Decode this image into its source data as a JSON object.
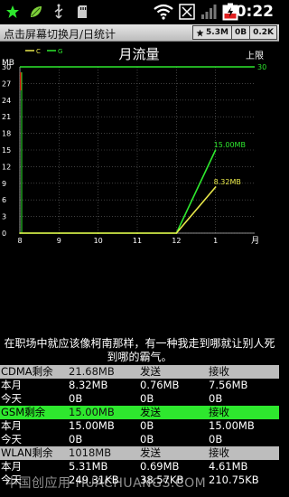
{
  "status_bar": {
    "time": "0:22",
    "icons": [
      "star-icon",
      "leaf-icon",
      "usb-icon",
      "sd-card-icon",
      "wifi-icon",
      "signal-off-icon",
      "battery-charging-icon"
    ],
    "colors": {
      "star": "#2ee82e",
      "leaf": "#7fd13b",
      "battery": "#e02020"
    }
  },
  "title_bar": {
    "title": "点击屏幕切换月/日统计",
    "speed_total": "5.3M",
    "speed_up": "0B",
    "speed_down": "0.2K"
  },
  "chart": {
    "title": "月流量",
    "unit_label": "MB",
    "limit_label": "上限",
    "limit_value_label": "30",
    "x_unit": "月",
    "legend": [
      {
        "name": "C",
        "color": "#e8e84a"
      },
      {
        "name": "G",
        "color": "#2ee82e"
      }
    ],
    "annotations": {
      "green_end": "15.00MB",
      "yellow_end": "8.32MB"
    }
  },
  "chart_data": {
    "type": "line",
    "title": "月流量",
    "xlabel": "月",
    "ylabel": "MB",
    "x_ticks": [
      "8",
      "9",
      "10",
      "11",
      "12",
      "1"
    ],
    "y_ticks": [
      "30",
      "27",
      "24",
      "21",
      "18",
      "15",
      "12",
      "9",
      "6",
      "3",
      "0"
    ],
    "ylim": [
      0,
      30
    ],
    "limit": 30,
    "grid": true,
    "series": [
      {
        "name": "G",
        "color": "#2ee82e",
        "x": [
          "8",
          "9",
          "10",
          "11",
          "12",
          "1"
        ],
        "values": [
          0,
          0,
          0,
          0,
          0,
          15.0
        ]
      },
      {
        "name": "C",
        "color": "#e8e84a",
        "x": [
          "8",
          "9",
          "10",
          "11",
          "12",
          "1"
        ],
        "values": [
          0,
          0,
          0,
          0,
          0,
          8.32
        ]
      }
    ],
    "limit_line_color": "#2ee82e",
    "marker_bar_color": "#d01010"
  },
  "quote": "在职场中就应该像柯南那样，有一种我走到哪就让别人死到哪的霸气。",
  "table": {
    "sections": [
      {
        "header": [
          "CDMA剩余",
          "21.68MB",
          "发送",
          "接收"
        ],
        "active": false,
        "rows": [
          [
            "本月",
            "8.32MB",
            "0.76MB",
            "7.56MB"
          ],
          [
            "今天",
            "0B",
            "0B",
            "0B"
          ]
        ]
      },
      {
        "header": [
          "GSM剩余",
          "15.00MB",
          "发送",
          "接收"
        ],
        "active": true,
        "rows": [
          [
            "本月",
            "15.00MB",
            "0B",
            "15.00MB"
          ],
          [
            "今天",
            "0B",
            "0B",
            "0B"
          ]
        ]
      },
      {
        "header": [
          "WLAN剩余",
          "1018MB",
          "发送",
          "接收"
        ],
        "active": false,
        "rows": [
          [
            "本月",
            "5.31MB",
            "0.69MB",
            "4.61MB"
          ],
          [
            "今天",
            "249.31KB",
            "38.57KB",
            "210.75KB"
          ]
        ]
      }
    ]
  },
  "watermark": "中国创应用 HUACHUANGS.COM"
}
